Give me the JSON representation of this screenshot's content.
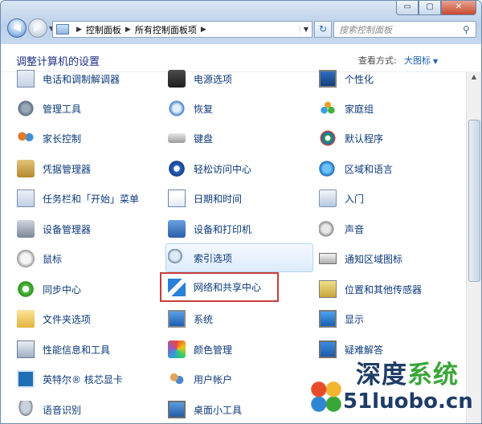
{
  "window": {
    "title_buttons": {
      "minimize": "▭",
      "maximize": "▢",
      "close": "✕"
    }
  },
  "nav": {
    "back_icon": "back-arrow-icon",
    "forward_icon": "forward-arrow-icon",
    "breadcrumb": [
      "控制面板",
      "所有控制面板项"
    ],
    "refresh_symbol": "↻",
    "search": {
      "placeholder": "搜索控制面板",
      "icon": "search-icon"
    }
  },
  "header": {
    "title": "调整计算机的设置",
    "view_label": "查看方式:",
    "view_value": "大图标"
  },
  "items": {
    "col1": [
      {
        "label": "电话和调制解调器",
        "icon": "phone-modem-icon"
      },
      {
        "label": "管理工具",
        "icon": "admin-tools-icon"
      },
      {
        "label": "家长控制",
        "icon": "parental-control-icon"
      },
      {
        "label": "凭据管理器",
        "icon": "credential-manager-icon"
      },
      {
        "label": "任务栏和「开始」菜单",
        "icon": "taskbar-icon"
      },
      {
        "label": "设备管理器",
        "icon": "device-manager-icon"
      },
      {
        "label": "鼠标",
        "icon": "mouse-icon"
      },
      {
        "label": "同步中心",
        "icon": "sync-center-icon"
      },
      {
        "label": "文件夹选项",
        "icon": "folder-options-icon"
      },
      {
        "label": "性能信息和工具",
        "icon": "performance-icon"
      },
      {
        "label": "英特尔® 核芯显卡",
        "icon": "intel-graphics-icon"
      },
      {
        "label": "语音识别",
        "icon": "speech-recognition-icon"
      }
    ],
    "col2": [
      {
        "label": "电源选项",
        "icon": "power-options-icon"
      },
      {
        "label": "恢复",
        "icon": "recovery-icon"
      },
      {
        "label": "键盘",
        "icon": "keyboard-icon"
      },
      {
        "label": "轻松访问中心",
        "icon": "ease-of-access-icon"
      },
      {
        "label": "日期和时间",
        "icon": "date-time-icon"
      },
      {
        "label": "设备和打印机",
        "icon": "devices-printers-icon"
      },
      {
        "label": "索引选项",
        "icon": "indexing-options-icon"
      },
      {
        "label": "网络和共享中心",
        "icon": "network-sharing-icon"
      },
      {
        "label": "系统",
        "icon": "system-icon"
      },
      {
        "label": "颜色管理",
        "icon": "color-management-icon"
      },
      {
        "label": "用户帐户",
        "icon": "user-accounts-icon"
      },
      {
        "label": "桌面小工具",
        "icon": "desktop-gadgets-icon"
      }
    ],
    "col3": [
      {
        "label": "个性化",
        "icon": "personalization-icon"
      },
      {
        "label": "家庭组",
        "icon": "homegroup-icon"
      },
      {
        "label": "默认程序",
        "icon": "default-programs-icon"
      },
      {
        "label": "区域和语言",
        "icon": "region-language-icon"
      },
      {
        "label": "入门",
        "icon": "getting-started-icon"
      },
      {
        "label": "声音",
        "icon": "sound-icon"
      },
      {
        "label": "通知区域图标",
        "icon": "notification-area-icon"
      },
      {
        "label": "位置和其他传感器",
        "icon": "location-sensors-icon"
      },
      {
        "label": "显示",
        "icon": "display-icon"
      },
      {
        "label": "疑难解答",
        "icon": "troubleshooting-icon"
      }
    ]
  },
  "highlighted_item": "网络和共享中心",
  "highlight_color": "#c83c3c",
  "watermark": {
    "line1_part1": "深度",
    "line1_part2": "系统",
    "url": "51luobo.cn"
  }
}
